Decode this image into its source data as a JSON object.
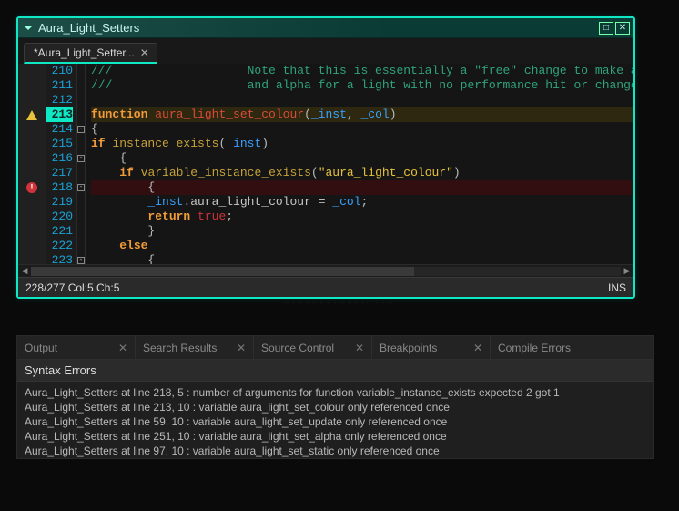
{
  "window": {
    "title": "Aura_Light_Setters"
  },
  "tab": {
    "label": "*Aura_Light_Setter..."
  },
  "gutter_start": 210,
  "highlight_line": 213,
  "fold_lines": [
    214,
    216,
    218,
    223
  ],
  "markers": {
    "213": "warn",
    "218": "error"
  },
  "code": {
    "l210": {
      "comment": "///                   Note that this is essentially a \"free\" change to make and y"
    },
    "l211": {
      "comment": "///                   and alpha for a light with no performance hit or changes to"
    },
    "l213": {
      "kw": "function",
      "fn": "aura_light_set_colour",
      "args": [
        "_inst",
        "_col"
      ]
    },
    "l214": {
      "brace": "{"
    },
    "l215": {
      "kw": "if",
      "builtin": "instance_exists",
      "arg": "_inst"
    },
    "l216": {
      "brace": "    {"
    },
    "l217": {
      "kw": "if",
      "builtin": "variable_instance_exists",
      "str": "\"aura_light_colour\""
    },
    "l218": {
      "brace": "        {"
    },
    "l219": {
      "arg": "_inst",
      "prop": "aura_light_colour",
      "rhs": "_col"
    },
    "l220": {
      "kw": "return",
      "const": "true"
    },
    "l221": {
      "brace": "        }"
    },
    "l222": {
      "kw": "else"
    },
    "l223": {
      "brace": "        {"
    }
  },
  "status": {
    "pos": "228/277 Col:5 Ch:5",
    "mode": "INS"
  },
  "panel_tabs": [
    "Output",
    "Search Results",
    "Source Control",
    "Breakpoints",
    "Compile Errors"
  ],
  "panel_header": "Syntax Errors",
  "errors": [
    "Aura_Light_Setters at line 218, 5 : number of arguments for function variable_instance_exists expected 2 got 1",
    "Aura_Light_Setters at line 213, 10 : variable aura_light_set_colour only referenced once",
    "Aura_Light_Setters at line 59, 10 : variable aura_light_set_update only referenced once",
    "Aura_Light_Setters at line 251, 10 : variable aura_light_set_alpha only referenced once",
    "Aura_Light_Setters at line 97, 10 : variable aura_light_set_static only referenced once"
  ]
}
